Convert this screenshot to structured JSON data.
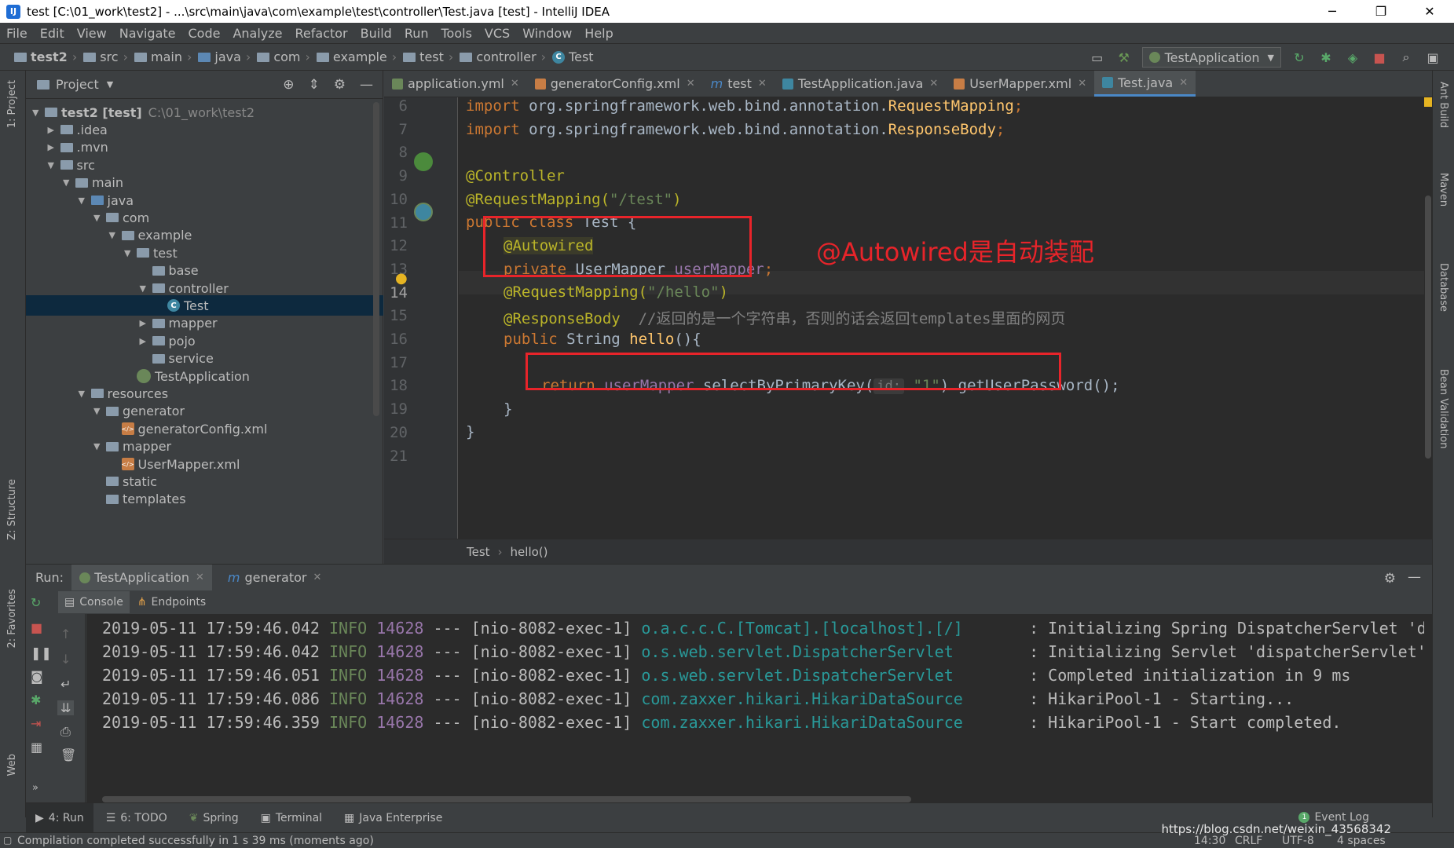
{
  "window": {
    "title": "test [C:\\01_work\\test2] - ...\\src\\main\\java\\com\\example\\test\\controller\\Test.java [test] - IntelliJ IDEA",
    "minimize": "─",
    "restore": "❐",
    "close": "✕"
  },
  "menu": [
    "File",
    "Edit",
    "View",
    "Navigate",
    "Code",
    "Analyze",
    "Refactor",
    "Build",
    "Run",
    "Tools",
    "VCS",
    "Window",
    "Help"
  ],
  "breadcrumbs": [
    "test2",
    "src",
    "main",
    "java",
    "com",
    "example",
    "test",
    "controller",
    "Test"
  ],
  "run_config": "TestApplication",
  "left_stripe": {
    "project": "1: Project",
    "structure": "Z: Structure",
    "favorites": "2: Favorites",
    "web": "Web"
  },
  "right_stripe": [
    "Ant Build",
    "Maven",
    "Database",
    "Bean Validation"
  ],
  "project_panel": {
    "title": "Project",
    "tree": [
      {
        "label": "test2 [test]",
        "extra": "C:\\01_work\\test2",
        "depth": 0,
        "expanded": true,
        "kind": "module"
      },
      {
        "label": ".idea",
        "depth": 1,
        "expanded": false,
        "kind": "folder"
      },
      {
        "label": ".mvn",
        "depth": 1,
        "expanded": false,
        "kind": "folder"
      },
      {
        "label": "src",
        "depth": 1,
        "expanded": true,
        "kind": "folder"
      },
      {
        "label": "main",
        "depth": 2,
        "expanded": true,
        "kind": "folder"
      },
      {
        "label": "java",
        "depth": 3,
        "expanded": true,
        "kind": "source"
      },
      {
        "label": "com",
        "depth": 4,
        "expanded": true,
        "kind": "folder"
      },
      {
        "label": "example",
        "depth": 5,
        "expanded": true,
        "kind": "folder"
      },
      {
        "label": "test",
        "depth": 6,
        "expanded": true,
        "kind": "folder"
      },
      {
        "label": "base",
        "depth": 7,
        "kind": "folder"
      },
      {
        "label": "controller",
        "depth": 7,
        "expanded": true,
        "kind": "folder"
      },
      {
        "label": "Test",
        "depth": 8,
        "kind": "class",
        "selected": true
      },
      {
        "label": "mapper",
        "depth": 7,
        "expanded": false,
        "kind": "folder"
      },
      {
        "label": "pojo",
        "depth": 7,
        "expanded": false,
        "kind": "folder"
      },
      {
        "label": "service",
        "depth": 7,
        "kind": "folder"
      },
      {
        "label": "TestApplication",
        "depth": 6,
        "kind": "spring"
      },
      {
        "label": "resources",
        "depth": 3,
        "expanded": true,
        "kind": "folder"
      },
      {
        "label": "generator",
        "depth": 4,
        "expanded": true,
        "kind": "folder"
      },
      {
        "label": "generatorConfig.xml",
        "depth": 5,
        "kind": "xml"
      },
      {
        "label": "mapper",
        "depth": 4,
        "expanded": true,
        "kind": "folder"
      },
      {
        "label": "UserMapper.xml",
        "depth": 5,
        "kind": "xml"
      },
      {
        "label": "static",
        "depth": 4,
        "kind": "folder"
      },
      {
        "label": "templates",
        "depth": 4,
        "kind": "folder"
      }
    ]
  },
  "tabs": [
    {
      "label": "application.yml",
      "color": "#6a8759"
    },
    {
      "label": "generatorConfig.xml",
      "color": "#c77d45"
    },
    {
      "label": "test",
      "color": "#4a88c7",
      "prefix": "m"
    },
    {
      "label": "TestApplication.java",
      "color": "#3e86a0"
    },
    {
      "label": "UserMapper.xml",
      "color": "#c77d45"
    },
    {
      "label": "Test.java",
      "color": "#3e86a0",
      "active": true
    }
  ],
  "code": {
    "lines": [
      "6",
      "7",
      "8",
      "9",
      "10",
      "11",
      "12",
      "13",
      "14",
      "15",
      "16",
      "17",
      "18",
      "19",
      "20",
      "21"
    ],
    "l6_kw": "import",
    "l6_pkg": " org.springframework.web.bind.annotation.",
    "l6_cls": "RequestMapping",
    "l6_end": ";",
    "l7_kw": "import",
    "l7_pkg": " org.springframework.web.bind.annotation.",
    "l7_cls": "ResponseBody",
    "l7_end": ";",
    "l9": "@Controller",
    "l10_ann": "@RequestMapping(",
    "l10_str": "\"/test\"",
    "l10_end": ")",
    "l11_kw": "public class",
    "l11_name": " Test {",
    "l12": "@Autowired",
    "l13_kw": "private",
    "l13_type": " UserMapper ",
    "l13_fld": "userMapper",
    "l13_end": ";",
    "l14_ann": "@RequestMapping(",
    "l14_str": "\"/hello\"",
    "l14_end": ")",
    "l15_ann": "@ResponseBody",
    "l15_cmt": "  //返回的是一个字符串，否则的话会返回templates里面的网页",
    "l16_kw": "public",
    "l16_type": " String ",
    "l16_fn": "hello",
    "l16_end": "(){",
    "l18_kw": "return",
    "l18_fld": " userMapper",
    "l18_mid": ".selectByPrimaryKey(",
    "l18_hint": "id:",
    "l18_str": "\"1\"",
    "l18_end": ").getUserPassword();",
    "l19": "}",
    "l20": "}"
  },
  "annotation_text": "@Autowired是自动装配",
  "editor_breadcrumb": [
    "Test",
    "hello()"
  ],
  "run_panel": {
    "label": "Run:",
    "tabs": [
      "TestApplication",
      "generator"
    ],
    "console_tabs": [
      "Console",
      "Endpoints"
    ],
    "logs": [
      {
        "date": "2019-05-11 17:59:46.042",
        "level": "INFO",
        "pid": "14628",
        "sep": "---",
        "thread": "[nio-8082-exec-1]",
        "logger": "o.a.c.c.C.[Tomcat].[localhost].[/]      ",
        "msg": ": Initializing Spring DispatcherServlet 'd"
      },
      {
        "date": "2019-05-11 17:59:46.042",
        "level": "INFO",
        "pid": "14628",
        "sep": "---",
        "thread": "[nio-8082-exec-1]",
        "logger": "o.s.web.servlet.DispatcherServlet       ",
        "msg": ": Initializing Servlet 'dispatcherServlet'"
      },
      {
        "date": "2019-05-11 17:59:46.051",
        "level": "INFO",
        "pid": "14628",
        "sep": "---",
        "thread": "[nio-8082-exec-1]",
        "logger": "o.s.web.servlet.DispatcherServlet       ",
        "msg": ": Completed initialization in 9 ms"
      },
      {
        "date": "2019-05-11 17:59:46.086",
        "level": "INFO",
        "pid": "14628",
        "sep": "---",
        "thread": "[nio-8082-exec-1]",
        "logger": "com.zaxxer.hikari.HikariDataSource      ",
        "msg": ": HikariPool-1 - Starting..."
      },
      {
        "date": "2019-05-11 17:59:46.359",
        "level": "INFO",
        "pid": "14628",
        "sep": "---",
        "thread": "[nio-8082-exec-1]",
        "logger": "com.zaxxer.hikari.HikariDataSource      ",
        "msg": ": HikariPool-1 - Start completed."
      }
    ]
  },
  "tool_tabs": [
    {
      "label": "4: Run",
      "active": true
    },
    {
      "label": "6: TODO"
    },
    {
      "label": "Spring"
    },
    {
      "label": "Terminal"
    },
    {
      "label": "Java Enterprise"
    }
  ],
  "event_log": "Event Log",
  "status": {
    "message": "Compilation completed successfully in 1 s 39 ms (moments ago)",
    "position": "14:30",
    "line_sep": "CRLF",
    "encoding": "UTF-8",
    "indent": "4 spaces"
  },
  "watermark": "https://blog.csdn.net/weixin_43568342"
}
